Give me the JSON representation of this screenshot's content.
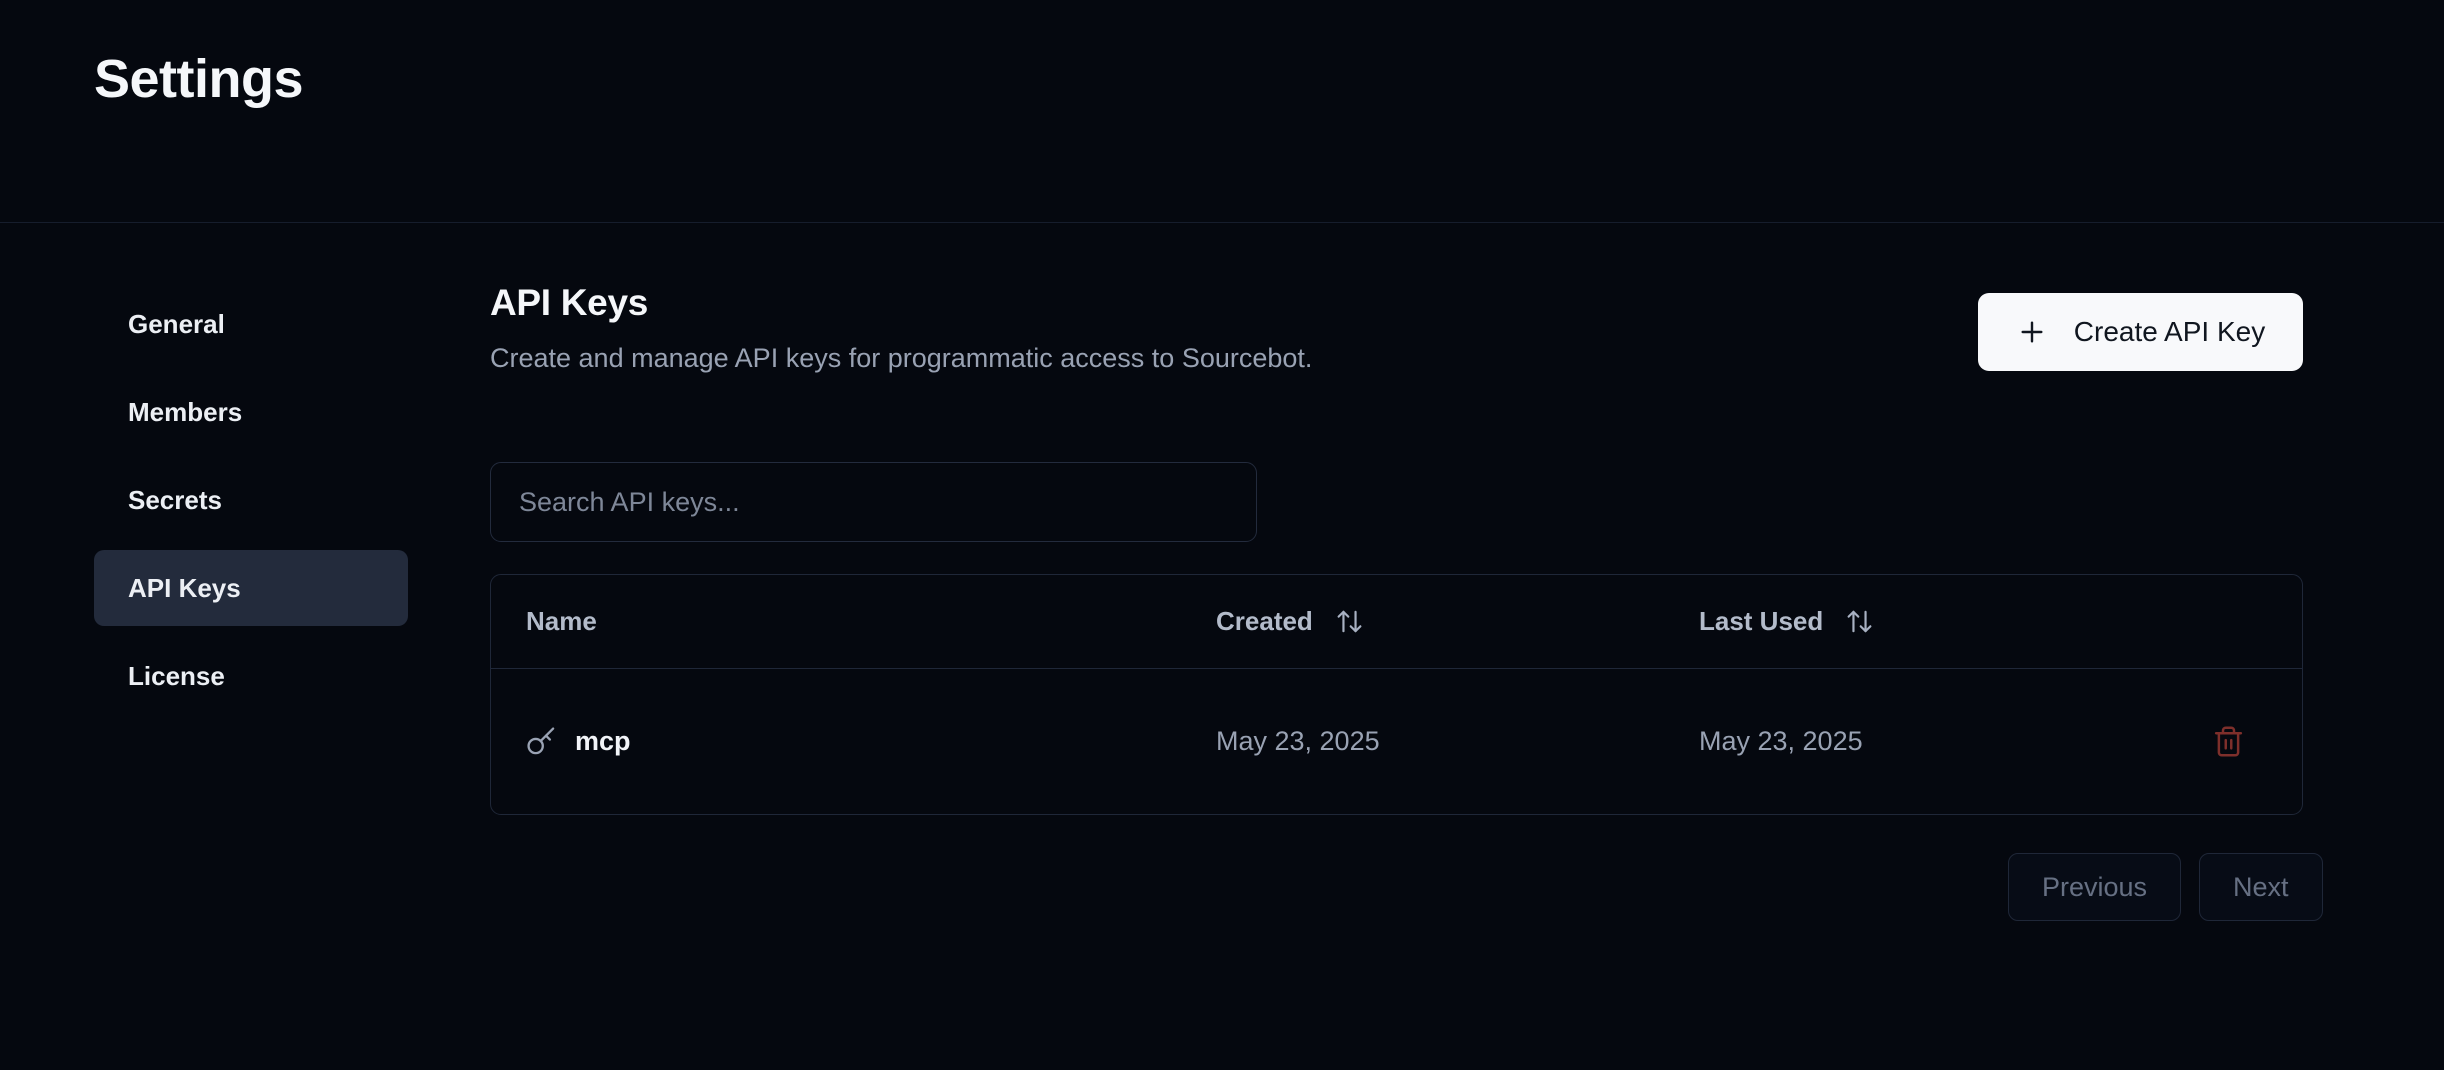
{
  "page": {
    "title": "Settings"
  },
  "sidebar": {
    "items": [
      {
        "label": "General",
        "selected": false
      },
      {
        "label": "Members",
        "selected": false
      },
      {
        "label": "Secrets",
        "selected": false
      },
      {
        "label": "API Keys",
        "selected": true
      },
      {
        "label": "License",
        "selected": false
      }
    ]
  },
  "main": {
    "title": "API Keys",
    "subtitle": "Create and manage API keys for programmatic access to Sourcebot.",
    "create_button": {
      "label": "Create API Key",
      "icon": "plus-icon"
    },
    "search": {
      "placeholder": "Search API keys...",
      "value": ""
    },
    "table": {
      "columns": [
        {
          "label": "Name",
          "sortable": false
        },
        {
          "label": "Created",
          "sortable": true,
          "sort_icon": "arrow-up-down-icon"
        },
        {
          "label": "Last Used",
          "sortable": true,
          "sort_icon": "arrow-up-down-icon"
        }
      ],
      "rows": [
        {
          "icon": "key-icon",
          "name": "mcp",
          "created": "May 23, 2025",
          "last_used": "May 23, 2025",
          "action_icon": "trash-icon"
        }
      ]
    },
    "pagination": {
      "previous_label": "Previous",
      "next_label": "Next"
    }
  },
  "colors": {
    "background": "#05080F",
    "sidebar_selected_bg": "#232B3C",
    "border": "#1F2738",
    "header_divider": "#161D2C",
    "primary_button_bg": "#F8F9FB",
    "primary_button_text": "#10161F",
    "muted_text": "#99A2B3",
    "destructive_icon": "#7E2F2B"
  }
}
